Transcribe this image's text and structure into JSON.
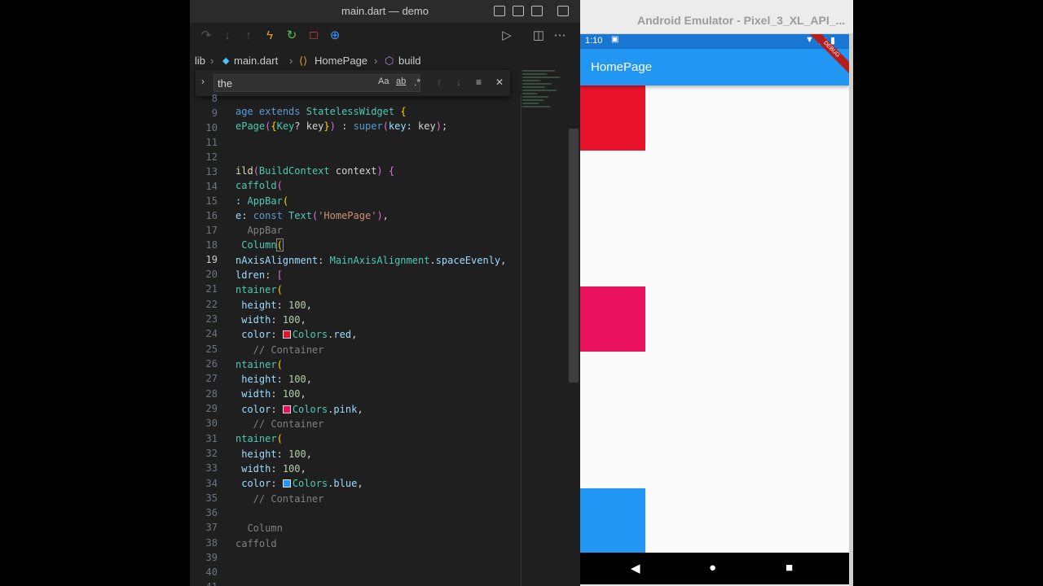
{
  "vscode": {
    "title": "main.dart — demo",
    "breadcrumb": [
      "lib",
      "main.dart",
      "HomePage",
      "build"
    ],
    "find": {
      "value": "the",
      "case_label": "Aa",
      "word_label": "ab",
      "regex_label": ".*"
    },
    "line_numbers": [
      "8",
      "9",
      "10",
      "11",
      "12",
      "13",
      "14",
      "15",
      "16",
      "17",
      "18",
      "19",
      "20",
      "21",
      "22",
      "23",
      "24",
      "25",
      "26",
      "27",
      "28",
      "29",
      "30",
      "31",
      "32",
      "33",
      "34",
      "35",
      "36",
      "37",
      "38",
      "39",
      "40",
      "41"
    ],
    "active_line": "19"
  },
  "emulator": {
    "title": "Android Emulator - Pixel_3_XL_API_...",
    "time": "1:10",
    "appbar_title": "HomePage",
    "debug_label": "DEBUG",
    "colors": {
      "red": "#e8132a",
      "pink": "#e9115b",
      "blue": "#2196f3",
      "appbar": "#2196f3"
    }
  }
}
